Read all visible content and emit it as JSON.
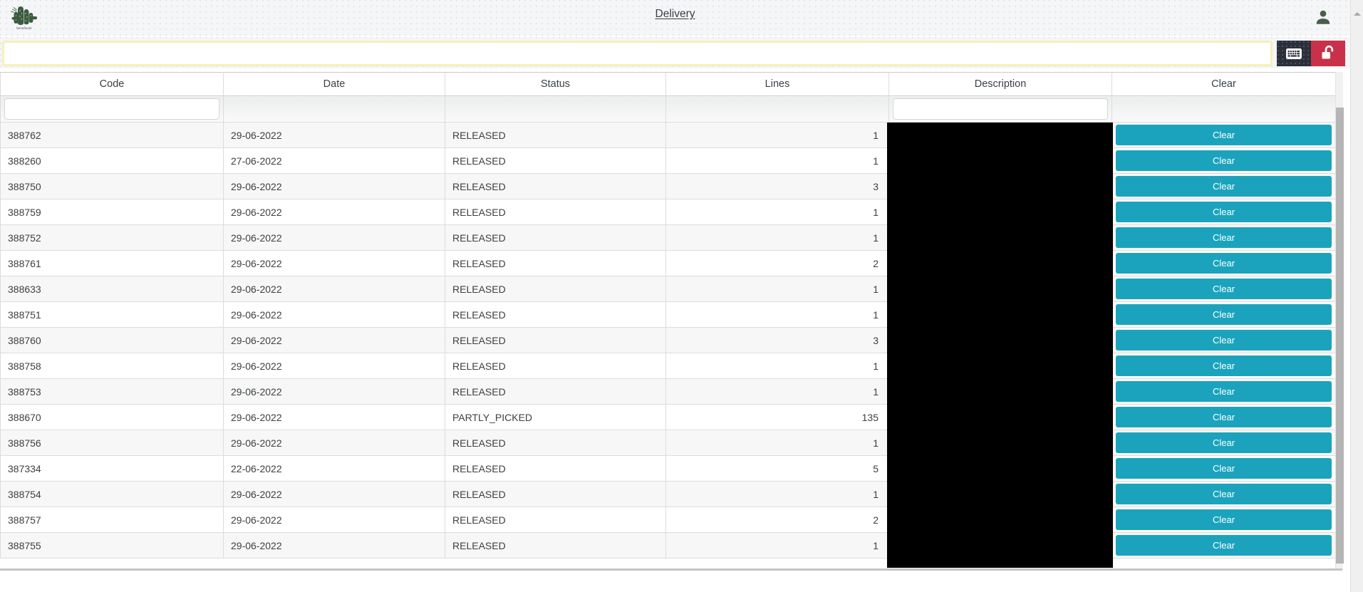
{
  "header": {
    "logo_caption": "beneficent",
    "logo_icon": "cactus-logo-icon",
    "title": "Delivery",
    "user_icon": "user-account-icon"
  },
  "search": {
    "value": "",
    "placeholder": "",
    "keyboard_button_icon": "keyboard-icon",
    "lock_button_icon": "unlock-open-padlock-icon"
  },
  "table": {
    "columns": [
      "Code",
      "Date",
      "Status",
      "Lines",
      "Description",
      "Clear"
    ],
    "filters": {
      "code": "",
      "code_placeholder": "",
      "description": "",
      "description_placeholder": ""
    },
    "clear_label": "Clear",
    "rows": [
      {
        "code": "388762",
        "date": "29-06-2022",
        "status": "RELEASED",
        "lines": "1",
        "description": ""
      },
      {
        "code": "388260",
        "date": "27-06-2022",
        "status": "RELEASED",
        "lines": "1",
        "description": ""
      },
      {
        "code": "388750",
        "date": "29-06-2022",
        "status": "RELEASED",
        "lines": "3",
        "description": ""
      },
      {
        "code": "388759",
        "date": "29-06-2022",
        "status": "RELEASED",
        "lines": "1",
        "description": ""
      },
      {
        "code": "388752",
        "date": "29-06-2022",
        "status": "RELEASED",
        "lines": "1",
        "description": ""
      },
      {
        "code": "388761",
        "date": "29-06-2022",
        "status": "RELEASED",
        "lines": "2",
        "description": ""
      },
      {
        "code": "388633",
        "date": "29-06-2022",
        "status": "RELEASED",
        "lines": "1",
        "description": ""
      },
      {
        "code": "388751",
        "date": "29-06-2022",
        "status": "RELEASED",
        "lines": "1",
        "description": ""
      },
      {
        "code": "388760",
        "date": "29-06-2022",
        "status": "RELEASED",
        "lines": "3",
        "description": ""
      },
      {
        "code": "388758",
        "date": "29-06-2022",
        "status": "RELEASED",
        "lines": "1",
        "description": ""
      },
      {
        "code": "388753",
        "date": "29-06-2022",
        "status": "RELEASED",
        "lines": "1",
        "description": ""
      },
      {
        "code": "388670",
        "date": "29-06-2022",
        "status": "PARTLY_PICKED",
        "lines": "135",
        "description": ""
      },
      {
        "code": "388756",
        "date": "29-06-2022",
        "status": "RELEASED",
        "lines": "1",
        "description": ""
      },
      {
        "code": "387334",
        "date": "22-06-2022",
        "status": "RELEASED",
        "lines": "5",
        "description": ""
      },
      {
        "code": "388754",
        "date": "29-06-2022",
        "status": "RELEASED",
        "lines": "1",
        "description": ""
      },
      {
        "code": "388757",
        "date": "29-06-2022",
        "status": "RELEASED",
        "lines": "2",
        "description": ""
      },
      {
        "code": "388755",
        "date": "29-06-2022",
        "status": "RELEASED",
        "lines": "1",
        "description": ""
      }
    ]
  },
  "colors": {
    "accent_teal": "#1ba3bd",
    "lock_red": "#c9314a",
    "keyboard_dark": "#2b2f3a",
    "focus_yellow": "#f7f0b8",
    "logo_green": "#3b5c3f"
  }
}
